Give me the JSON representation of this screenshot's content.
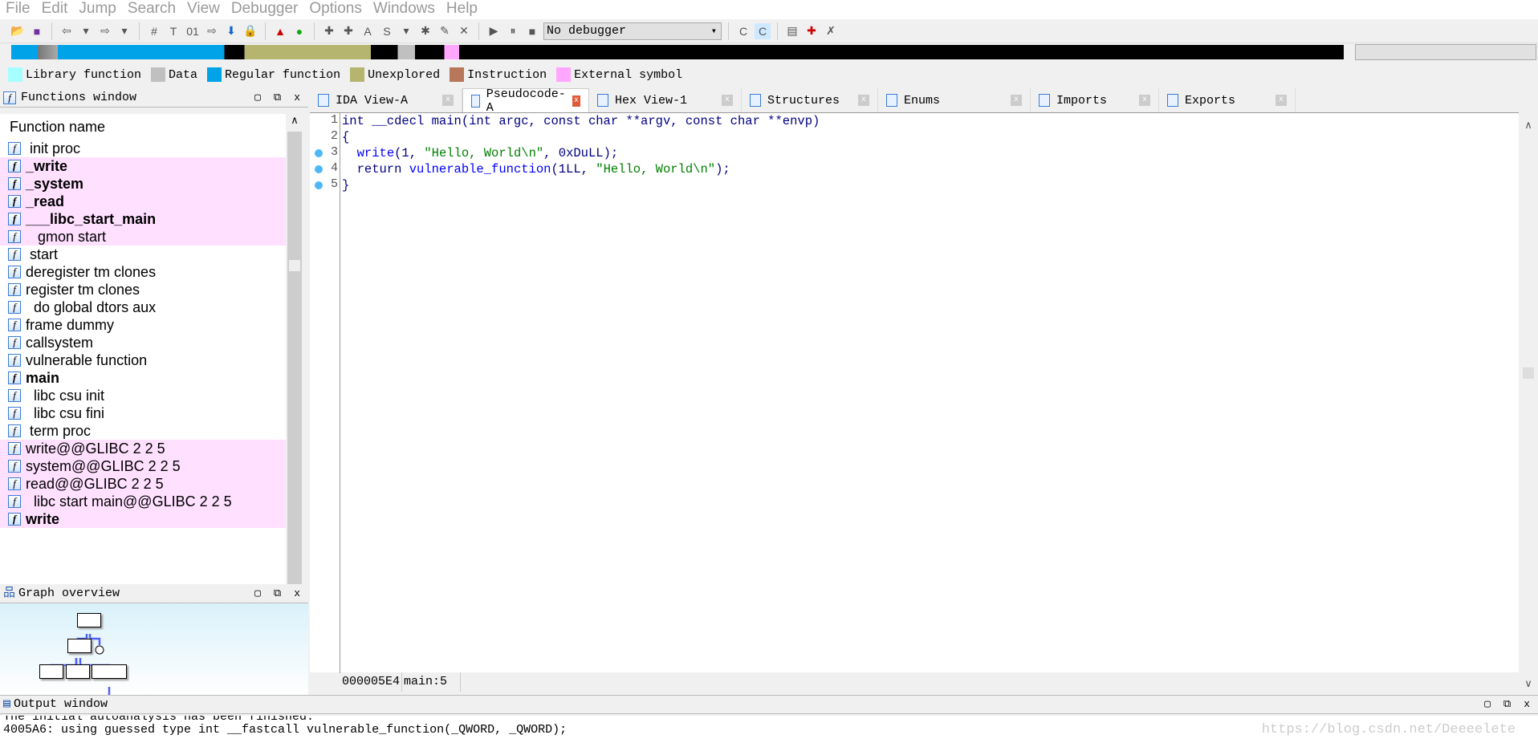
{
  "menu": [
    "File",
    "Edit",
    "Jump",
    "Search",
    "View",
    "Debugger",
    "Options",
    "Windows",
    "Help"
  ],
  "toolbar": {
    "debugger_select": "No debugger"
  },
  "legend": [
    {
      "label": "Library function",
      "color": "#a6ffff"
    },
    {
      "label": "Data",
      "color": "#c0c0c0"
    },
    {
      "label": "Regular function",
      "color": "#00a2e8"
    },
    {
      "label": "Unexplored",
      "color": "#b5b56f"
    },
    {
      "label": "Instruction",
      "color": "#b7775a"
    },
    {
      "label": "External symbol",
      "color": "#ffa6ff"
    }
  ],
  "functions_window": {
    "title": "Functions window",
    "column": "Function name",
    "items": [
      {
        "name": " init proc",
        "pink": false,
        "bold": false
      },
      {
        "name": "_write",
        "pink": true,
        "bold": true
      },
      {
        "name": "_system",
        "pink": true,
        "bold": true
      },
      {
        "name": "_read",
        "pink": true,
        "bold": true
      },
      {
        "name": "___libc_start_main",
        "pink": true,
        "bold": true
      },
      {
        "name": "   gmon start",
        "pink": true,
        "bold": false
      },
      {
        "name": " start",
        "pink": false,
        "bold": false
      },
      {
        "name": "deregister tm clones",
        "pink": false,
        "bold": false
      },
      {
        "name": "register tm clones",
        "pink": false,
        "bold": false
      },
      {
        "name": "  do global dtors aux",
        "pink": false,
        "bold": false
      },
      {
        "name": "frame dummy",
        "pink": false,
        "bold": false
      },
      {
        "name": "callsystem",
        "pink": false,
        "bold": false
      },
      {
        "name": "vulnerable function",
        "pink": false,
        "bold": false
      },
      {
        "name": "main",
        "pink": false,
        "bold": true
      },
      {
        "name": "  libc csu init",
        "pink": false,
        "bold": false
      },
      {
        "name": "  libc csu fini",
        "pink": false,
        "bold": false
      },
      {
        "name": " term proc",
        "pink": false,
        "bold": false
      },
      {
        "name": "write@@GLIBC 2 2 5",
        "pink": true,
        "bold": false
      },
      {
        "name": "system@@GLIBC 2 2 5",
        "pink": true,
        "bold": false
      },
      {
        "name": "read@@GLIBC 2 2 5",
        "pink": true,
        "bold": false
      },
      {
        "name": "  libc start main@@GLIBC 2 2 5",
        "pink": true,
        "bold": false
      },
      {
        "name": "write",
        "pink": true,
        "bold": true
      }
    ]
  },
  "graph_overview": {
    "title": "Graph overview"
  },
  "tabs": [
    {
      "label": "IDA View-A",
      "active": false
    },
    {
      "label": "Pseudocode-A",
      "active": true
    },
    {
      "label": "Hex View-1",
      "active": false
    },
    {
      "label": "Structures",
      "active": false
    },
    {
      "label": "Enums",
      "active": false
    },
    {
      "label": "Imports",
      "active": false
    },
    {
      "label": "Exports",
      "active": false
    }
  ],
  "code": {
    "line_numbers": [
      "1",
      "2",
      "3",
      "4",
      "5"
    ],
    "lines": [
      [
        {
          "t": "int __cdecl main(int argc, const char **argv, const char **envp)",
          "c": ""
        }
      ],
      [
        {
          "t": "{",
          "c": ""
        }
      ],
      [
        {
          "t": "  ",
          "c": ""
        },
        {
          "t": "write",
          "c": "kw"
        },
        {
          "t": "(1, ",
          "c": ""
        },
        {
          "t": "\"Hello, World\\n\"",
          "c": "str"
        },
        {
          "t": ", 0xDuLL);",
          "c": ""
        }
      ],
      [
        {
          "t": "  return ",
          "c": ""
        },
        {
          "t": "vulnerable_function",
          "c": "kw"
        },
        {
          "t": "(1LL, ",
          "c": ""
        },
        {
          "t": "\"Hello, World\\n\"",
          "c": "str"
        },
        {
          "t": ");",
          "c": ""
        }
      ],
      [
        {
          "t": "}",
          "c": ""
        }
      ]
    ]
  },
  "status": {
    "address": "000005E4",
    "location": "main:5"
  },
  "output_window": {
    "title": "Output window",
    "lines": [
      "The initial autoanalysis has been finished.",
      "4005A6: using guessed type int __fastcall vulnerable_function(_QWORD, _QWORD);"
    ]
  },
  "watermark": "https://blog.csdn.net/Deeeelete"
}
